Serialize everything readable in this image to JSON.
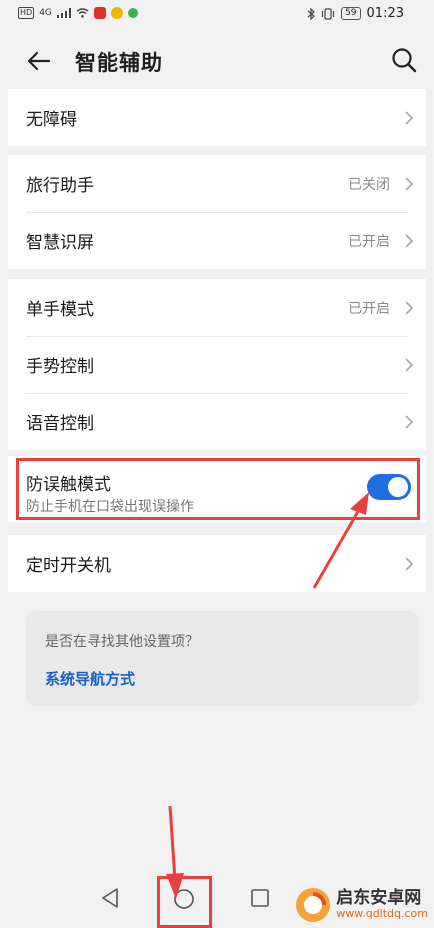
{
  "status_bar": {
    "hd": "HD",
    "signal": "4G",
    "battery": "59",
    "time": "01:23"
  },
  "header": {
    "title": "智能辅助"
  },
  "sections": {
    "accessibility": {
      "label": "无障碍"
    },
    "travel_assistant": {
      "label": "旅行助手",
      "status": "已关闭"
    },
    "smart_screen": {
      "label": "智慧识屏",
      "status": "已开启"
    },
    "one_hand": {
      "label": "单手模式",
      "status": "已开启"
    },
    "gesture": {
      "label": "手势控制"
    },
    "voice": {
      "label": "语音控制"
    },
    "accidental_touch": {
      "label": "防误触模式",
      "sublabel": "防止手机在口袋出现误操作",
      "enabled": true
    },
    "scheduled_power": {
      "label": "定时开关机"
    }
  },
  "suggestion": {
    "question": "是否在寻找其他设置项？",
    "link": "系统导航方式"
  },
  "watermark": {
    "title": "启东安卓网",
    "url": "www.qdltdq.com"
  },
  "colors": {
    "accent": "#1f6fe0",
    "highlight": "#e8413d",
    "link": "#1660c6"
  }
}
